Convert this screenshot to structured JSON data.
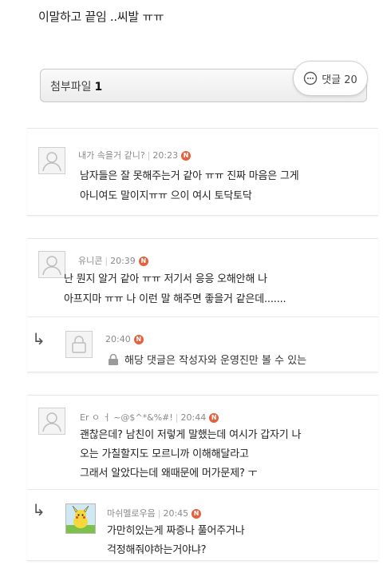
{
  "post": {
    "last_line": "이말하고 끝임 ..씨발 ㅠㅠ"
  },
  "attachment": {
    "label": "첨부파일",
    "count": "1"
  },
  "comments_button": {
    "label": "댓글 20"
  },
  "comments": [
    {
      "author": "내가 속을거 같니?",
      "time": "20:23",
      "badge": "N",
      "lines": [
        "남자들은 잘 못해주는거 같아 ㅠㅠ 진짜 마음은 그게",
        "아니여도 말이지ㅠㅠ 으이 여시 토닥토닥"
      ]
    },
    {
      "author": "유니콘",
      "time": "20:39",
      "badge": "N",
      "lines": [
        "난 뭔지 알거 같아 ㅠㅠ 저기서 응응 오해안해 나",
        "아프지마 ㅠㅠ 나 이런 말 해주면 좋을거 같은데......."
      ]
    },
    {
      "time": "20:40",
      "badge": "N",
      "locked_text": "해당 댓글은 작성자와 운영진만 볼 수 있는"
    },
    {
      "author": "Er ㅇ ㅓ ~@$^*&%#!",
      "time": "20:44",
      "badge": "N",
      "lines": [
        "괜찮은데? 남친이 저렇게 말했는데 여시가 갑자기 나",
        "오는 가칠할지도 모르니까 이해해달라고",
        "그래서 알았다는데 왜때문에 머가문제? ㅜ"
      ]
    },
    {
      "author": "마쉬멜로우음",
      "time": "20:45",
      "badge": "N",
      "lines": [
        "가만히있는게 짜증나 풀어주거나",
        "걱정해줘야하는거야냐?"
      ]
    }
  ],
  "icons": {
    "reply": "↳",
    "comment": "speech-bubble-icon",
    "lock": "lock-icon",
    "avatar_default": "user-silhouette-icon",
    "avatar_pikachu": "pikachu-avatar"
  },
  "colors": {
    "new_badge": "#e3613d",
    "meta": "#8a8a8a"
  }
}
